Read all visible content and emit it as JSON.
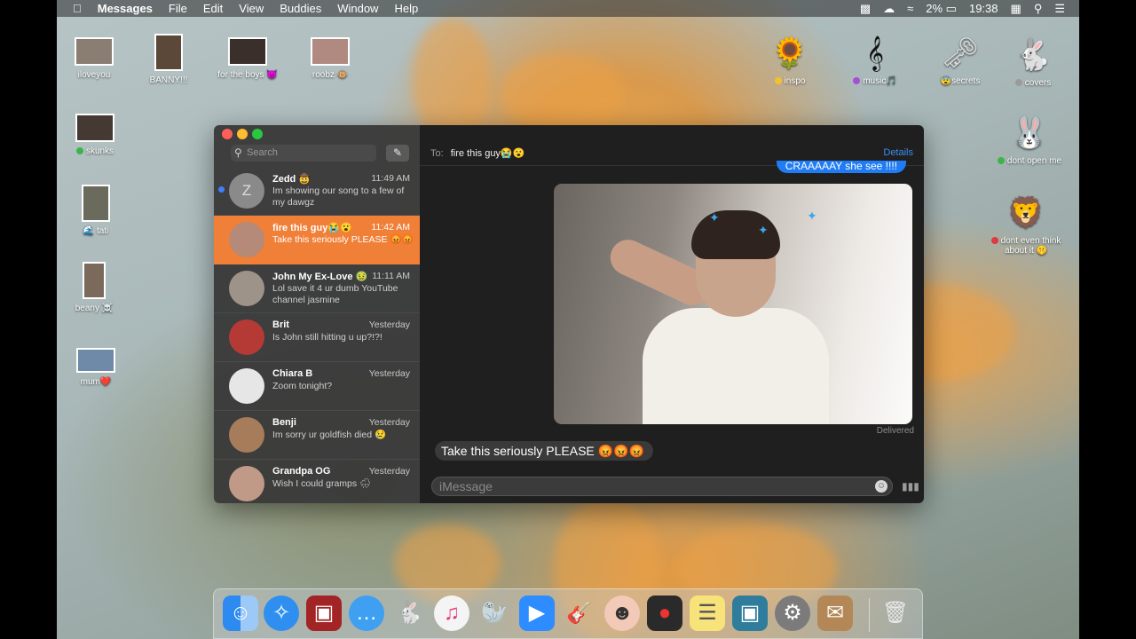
{
  "menubar": {
    "apple_icon": "apple-icon",
    "items": [
      "Messages",
      "File",
      "Edit",
      "View",
      "Buddies",
      "Window",
      "Help"
    ],
    "battery": "2%",
    "clock": "19:38"
  },
  "desktop_icons_left": [
    {
      "label": "iloveyou"
    },
    {
      "label": "BANNY!!!"
    },
    {
      "label": "for the boys 😈"
    },
    {
      "label": "roobz 🐵"
    },
    {
      "label": "skunks"
    },
    {
      "label": "tati"
    },
    {
      "label": "beany ☠️"
    },
    {
      "label": "mum❤️"
    }
  ],
  "desktop_icons_right": [
    {
      "label": "inspo",
      "dot": "#f2c12e"
    },
    {
      "label": "music🎵",
      "dot": "#a94fd6"
    },
    {
      "label": "😨secrets"
    },
    {
      "label": "covers",
      "dot": "#9a9a9a"
    },
    {
      "label": "dont open me",
      "dot": "#3ab54a"
    },
    {
      "label": "dont even think about it 🤫",
      "dot": "#e0393e"
    }
  ],
  "sidebar": {
    "search_placeholder": "Search",
    "conversations": [
      {
        "name": "Zedd 🤠",
        "time": "11:49 AM",
        "preview": "Im showing our song to a few of my dawgz",
        "avatar": "Z",
        "unread": true,
        "selected": false
      },
      {
        "name": "fire this guy😭😮",
        "time": "11:42 AM",
        "preview": "Take this seriously PLEASE 😡😡",
        "selected": true
      },
      {
        "name": "John My Ex-Love 🤢",
        "time": "11:11 AM",
        "preview": "Lol save it 4 ur dumb YouTube channel jasmine",
        "selected": false
      },
      {
        "name": "Brit",
        "time": "Yesterday",
        "preview": "Is John still hitting u up?!?!",
        "selected": false
      },
      {
        "name": "Chiara B",
        "time": "Yesterday",
        "preview": "Zoom tonight?",
        "selected": false
      },
      {
        "name": "Benji",
        "time": "Yesterday",
        "preview": "Im sorry ur goldfish died 😢",
        "selected": false
      },
      {
        "name": "Grandpa OG",
        "time": "Yesterday",
        "preview": "Wish I could gramps 🌧",
        "selected": false
      }
    ]
  },
  "chat": {
    "to_label": "To:",
    "recipient": "fire this guy😭😮",
    "details": "Details",
    "sent_text": "CRAAAAAY she see !!!!",
    "delivered": "Delivered",
    "received_text": "Take this seriously PLEASE 😡😡😡",
    "input_placeholder": "iMessage"
  },
  "dock": {
    "apps": [
      "finder-icon",
      "safari-icon",
      "photo-booth-icon",
      "messages-icon",
      "rabbit-icon",
      "itunes-icon",
      "seal-icon",
      "zoom-icon",
      "garageband-icon",
      "face-icon",
      "photos-icon",
      "notes-icon",
      "preview-icon",
      "system-preferences-icon",
      "contacts-icon",
      "trash-icon"
    ]
  }
}
